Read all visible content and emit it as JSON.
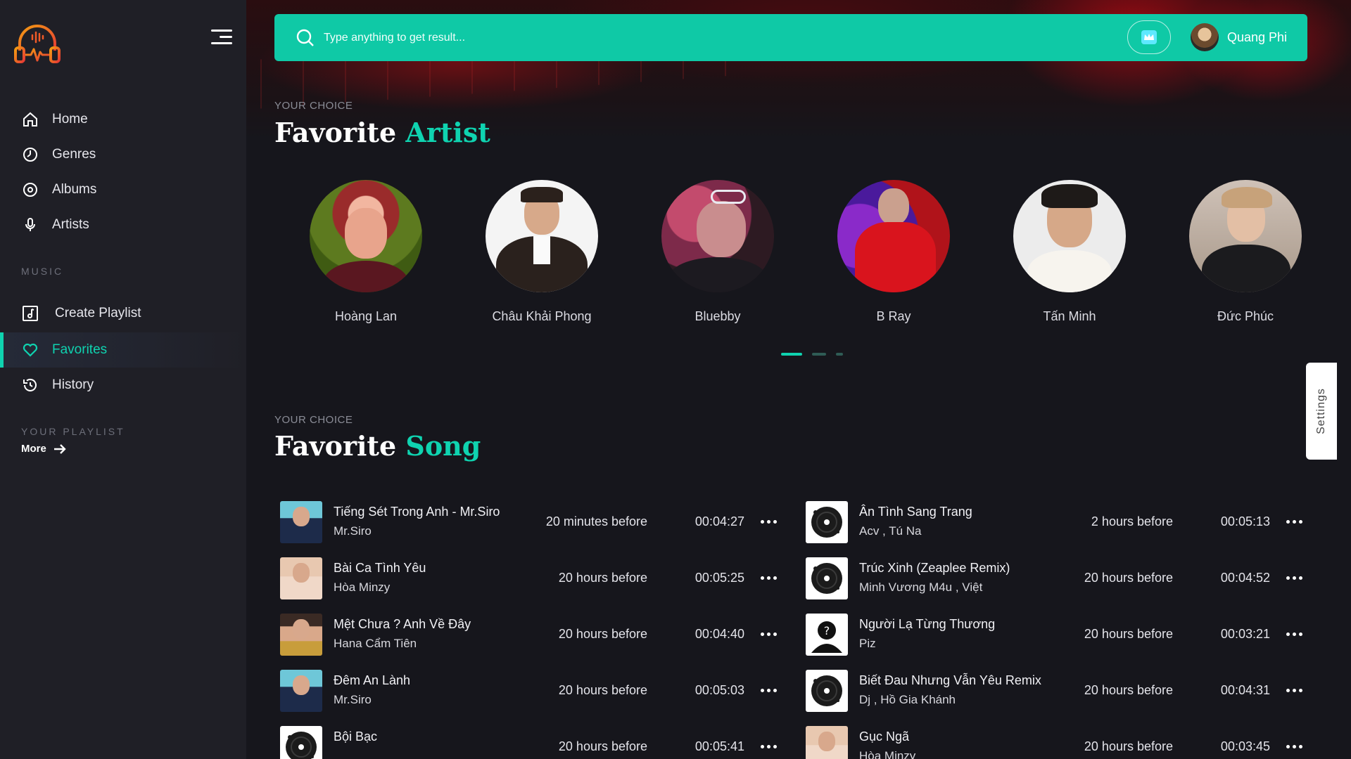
{
  "sidebar": {
    "nav": [
      {
        "label": "Home",
        "icon": "home-icon"
      },
      {
        "label": "Genres",
        "icon": "genres-icon"
      },
      {
        "label": "Albums",
        "icon": "albums-icon"
      },
      {
        "label": "Artists",
        "icon": "microphone-icon"
      }
    ],
    "music_label": "MUSIC",
    "music_items": [
      {
        "label": "Create Playlist",
        "icon": "playlist-add-icon"
      },
      {
        "label": "Favorites",
        "icon": "heart-icon",
        "active": true
      },
      {
        "label": "History",
        "icon": "history-icon"
      }
    ],
    "playlist_label": "YOUR PLAYLIST",
    "more_label": "More"
  },
  "header": {
    "search_placeholder": "Type anything to get result...",
    "user_name": "Quang Phi"
  },
  "artist_section": {
    "eyebrow": "YOUR CHOICE",
    "title_main": "Favorite ",
    "title_accent": "Artist",
    "artists": [
      {
        "name": "Hoàng Lan"
      },
      {
        "name": "Châu Khải Phong"
      },
      {
        "name": "Bluebby"
      },
      {
        "name": "B Ray"
      },
      {
        "name": "Tấn Minh"
      },
      {
        "name": "Đức Phúc"
      }
    ],
    "carousel_pages": 3,
    "carousel_active": 1
  },
  "song_section": {
    "eyebrow": "YOUR CHOICE",
    "title_main": "Favorite ",
    "title_accent": "Song",
    "songs": [
      {
        "title": "Tiếng Sét Trong Anh - Mr.Siro",
        "artist": "Mr.Siro",
        "added": "20 minutes before",
        "duration": "00:04:27",
        "thumb": "siro"
      },
      {
        "title": "Ân Tình Sang Trang",
        "artist": "Acv , Tú Na",
        "added": "2 hours before",
        "duration": "00:05:13",
        "thumb": "disc"
      },
      {
        "title": "Bài Ca Tình Yêu",
        "artist": "Hòa Minzy",
        "added": "20 hours before",
        "duration": "00:05:25",
        "thumb": "minzy"
      },
      {
        "title": "Trúc Xinh (Zeaplee Remix)",
        "artist": "Minh Vương M4u , Việt",
        "added": "20 hours before",
        "duration": "00:04:52",
        "thumb": "disc"
      },
      {
        "title": "Mệt Chưa ? Anh Về Đây",
        "artist": "Hana Cẩm Tiên",
        "added": "20 hours before",
        "duration": "00:04:40",
        "thumb": "hana"
      },
      {
        "title": "Người Lạ Từng Thương",
        "artist": "Piz",
        "added": "20 hours before",
        "duration": "00:03:21",
        "thumb": "unknown"
      },
      {
        "title": "Đêm An Lành",
        "artist": "Mr.Siro",
        "added": "20 hours before",
        "duration": "00:05:03",
        "thumb": "siro"
      },
      {
        "title": "Biết Đau Nhưng Vẫn Yêu Remix",
        "artist": "Dj , Hồ Gia Khánh",
        "added": "20 hours before",
        "duration": "00:04:31",
        "thumb": "disc"
      },
      {
        "title": "Bội Bạc",
        "artist": "",
        "added": "20 hours before",
        "duration": "00:05:41",
        "thumb": "disc"
      },
      {
        "title": "Gục Ngã",
        "artist": "Hòa Minzy",
        "added": "20 hours before",
        "duration": "00:03:45",
        "thumb": "minzy"
      }
    ]
  },
  "settings_label": "Settings",
  "colors": {
    "accent": "#0fd3b0",
    "search_bg": "#0fc9a6",
    "sidebar_bg": "#1f1f26",
    "page_bg": "#16161c"
  }
}
